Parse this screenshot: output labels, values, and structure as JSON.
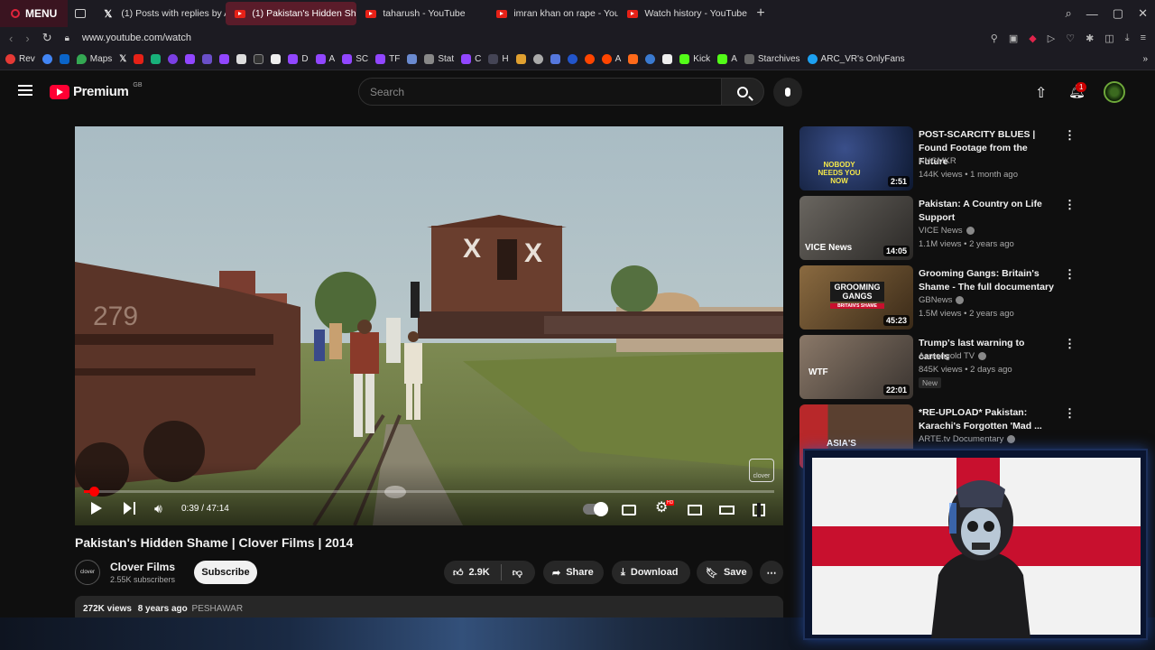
{
  "browser": {
    "menu_label": "MENU",
    "tabs": [
      {
        "label": "(1) Posts with replies by A",
        "icon": "x-icon"
      },
      {
        "label": "(1) Pakistan's Hidden Sha",
        "icon": "youtube-icon",
        "active": true
      },
      {
        "label": "taharush - YouTube",
        "icon": "youtube-icon"
      },
      {
        "label": "imran khan on rape - You",
        "icon": "youtube-icon"
      },
      {
        "label": "Watch history - YouTube",
        "icon": "youtube-icon"
      }
    ],
    "url": "www.youtube.com/watch",
    "bookmarks": [
      "Rev",
      "Maps",
      "A",
      "D",
      "A",
      "SC",
      "TF",
      "Stat",
      "C",
      "H",
      "A",
      "Kick",
      "A",
      "Starchives",
      "ARC_VR's OnlyFans"
    ]
  },
  "youtube": {
    "logo_text": "Premium",
    "region": "GB",
    "search_placeholder": "Search",
    "notification_count": "1"
  },
  "video": {
    "title": "Pakistan's Hidden Shame | Clover Films | 2014",
    "time": "0:39 / 47:14",
    "progress": 0.014,
    "watermark": "clover",
    "channel_name": "Clover Films",
    "channel_avatar_text": "clover",
    "subscribers": "2.55K subscribers",
    "subscribe_label": "Subscribe",
    "likes": "2.9K",
    "share_label": "Share",
    "download_label": "Download",
    "save_label": "Save",
    "views": "272K views",
    "age": "8 years ago",
    "location": "PESHAWAR",
    "hd_label": "HD"
  },
  "recommendations": [
    {
      "title": "POST-SCARCITY BLUES | Found Footage from the Future",
      "channel": "KNGMKR",
      "verified": false,
      "meta": "144K views • 1 month ago",
      "duration": "2:51",
      "thumb_text": "NOBODY NEEDS YOU NOW",
      "colors": [
        "#3a4f8a",
        "#0d1830"
      ]
    },
    {
      "title": "Pakistan: A Country on Life Support",
      "channel": "VICE News",
      "verified": true,
      "meta": "1.1M views • 2 years ago",
      "duration": "14:05",
      "thumb_text": "VICE News",
      "colors": [
        "#6a6660",
        "#2a2826"
      ]
    },
    {
      "title": "Grooming Gangs: Britain's Shame - The full documentary",
      "channel": "GBNews",
      "verified": true,
      "meta": "1.5M views • 2 years ago",
      "duration": "45:23",
      "thumb_text": "GROOMING GANGS",
      "thumb_sub": "BRITAIN'S SHAME",
      "colors": [
        "#8a6a40",
        "#3a2a18"
      ]
    },
    {
      "title": "Trump's last warning to cartels",
      "channel": "Asmongold TV",
      "verified": true,
      "meta": "845K views • 2 days ago",
      "duration": "22:01",
      "thumb_text": "WTF",
      "badge": "New",
      "colors": [
        "#8a7868",
        "#3a3430"
      ]
    },
    {
      "title": "*RE-UPLOAD* Pakistan: Karachi's Forgotten 'Mad ...",
      "channel": "ARTE.tv Documentary",
      "verified": true,
      "meta": "",
      "duration": "",
      "thumb_text": "ASIA'S",
      "colors": [
        "#b8282a",
        "#5a4030"
      ]
    }
  ]
}
